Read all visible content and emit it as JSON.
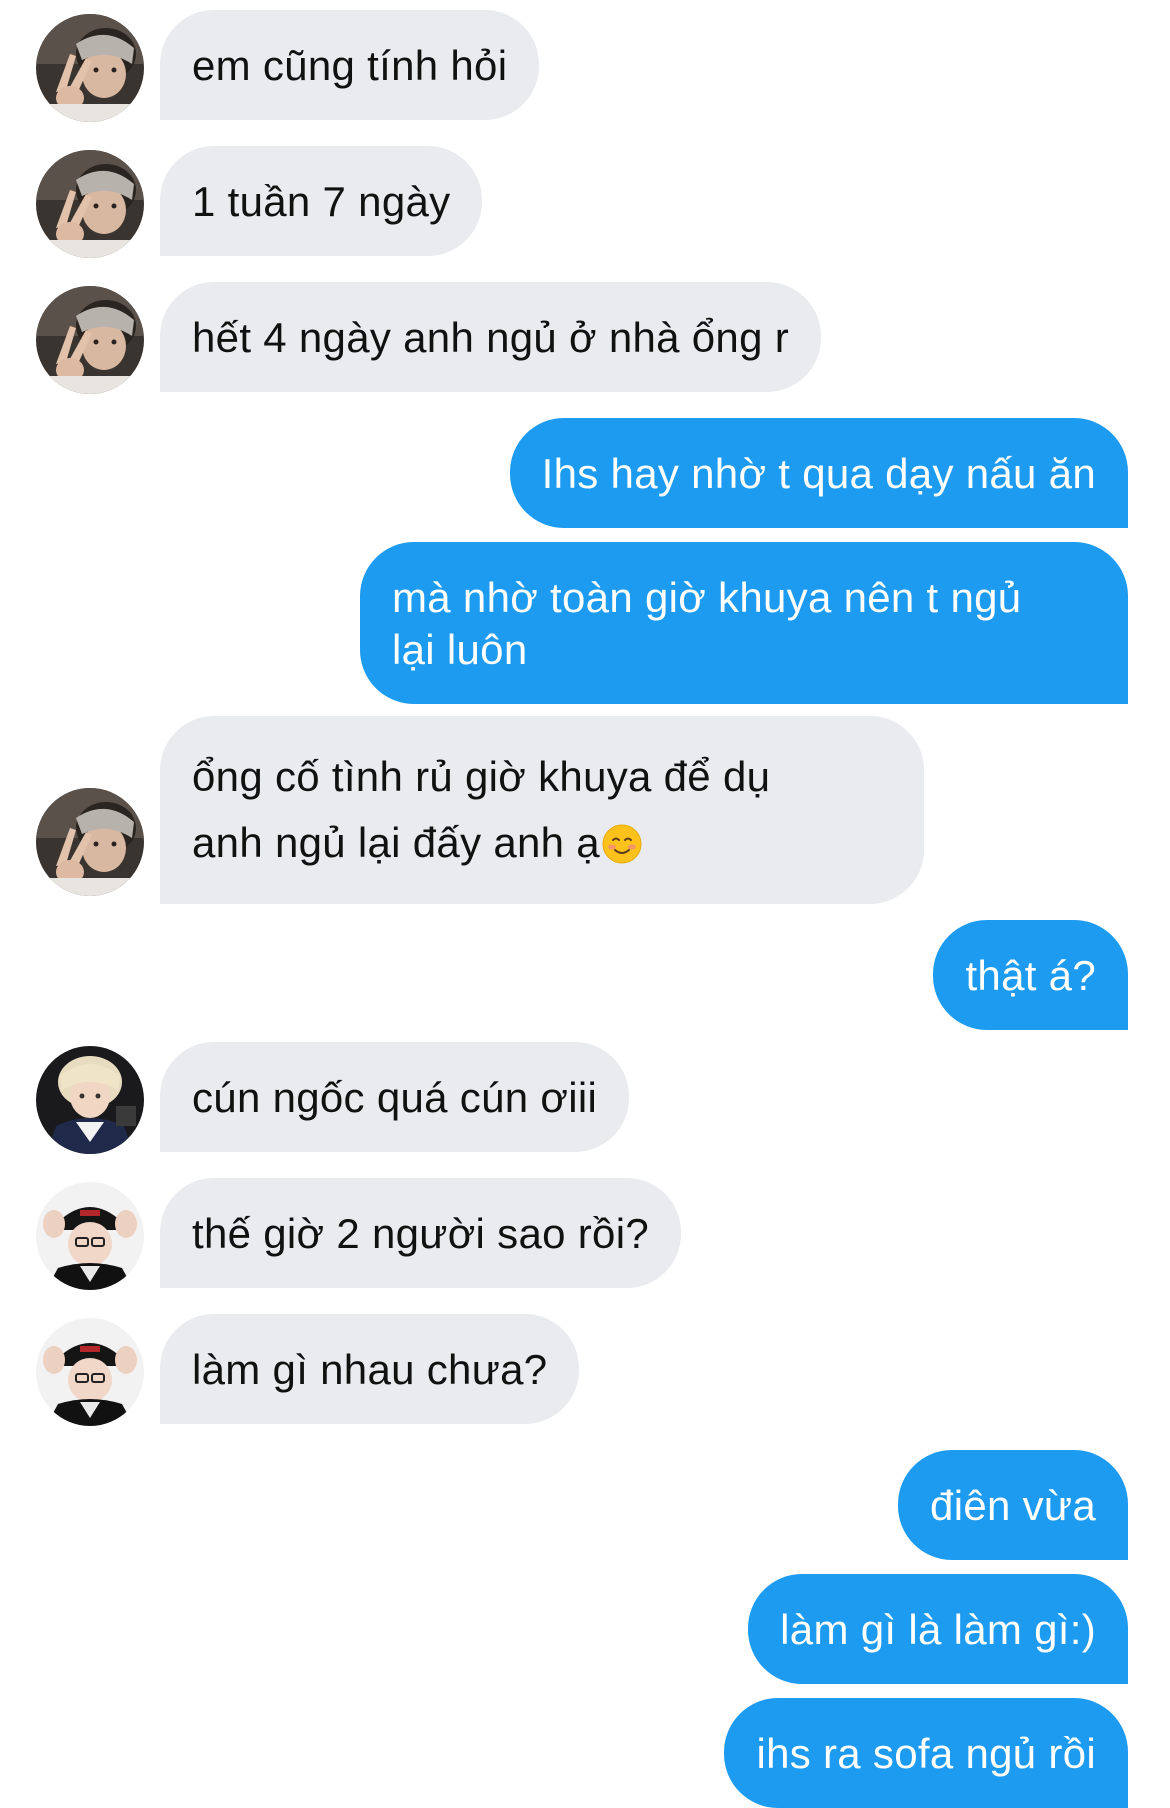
{
  "messages": [
    {
      "text": "em cũng tính hỏi",
      "avatar": "avatar-a"
    },
    {
      "text": "1 tuần 7 ngày",
      "avatar": "avatar-a"
    },
    {
      "text": "hết 4 ngày anh ngủ ở nhà ổng r",
      "avatar": "avatar-a"
    },
    {
      "text": "Ihs hay nhờ t qua dạy nấu ăn"
    },
    {
      "line1": "mà nhờ toàn giờ khuya nên t ngủ",
      "line2": "lại luôn"
    },
    {
      "line1": "ổng cố tình rủ giờ khuya để dụ",
      "line2": "anh ngủ lại đấy anh ạ",
      "emoji": "smiling-blush-emoji",
      "avatar": "avatar-a"
    },
    {
      "text": "thật á?"
    },
    {
      "text": "cún ngốc quá cún ơiii",
      "avatar": "avatar-b"
    },
    {
      "text": "thế giờ 2 người sao rồi?",
      "avatar": "avatar-c"
    },
    {
      "text": "làm gì nhau chưa?",
      "avatar": "avatar-c"
    },
    {
      "text": "điên vừa"
    },
    {
      "text": "làm gì là làm gì:)"
    },
    {
      "text": "ihs ra sofa ngủ rồi"
    }
  ],
  "colors": {
    "incoming_bubble": "#e9ebee",
    "outgoing_bubble": "#1d9bf0",
    "incoming_text": "#111111",
    "outgoing_text": "#ffffff"
  }
}
